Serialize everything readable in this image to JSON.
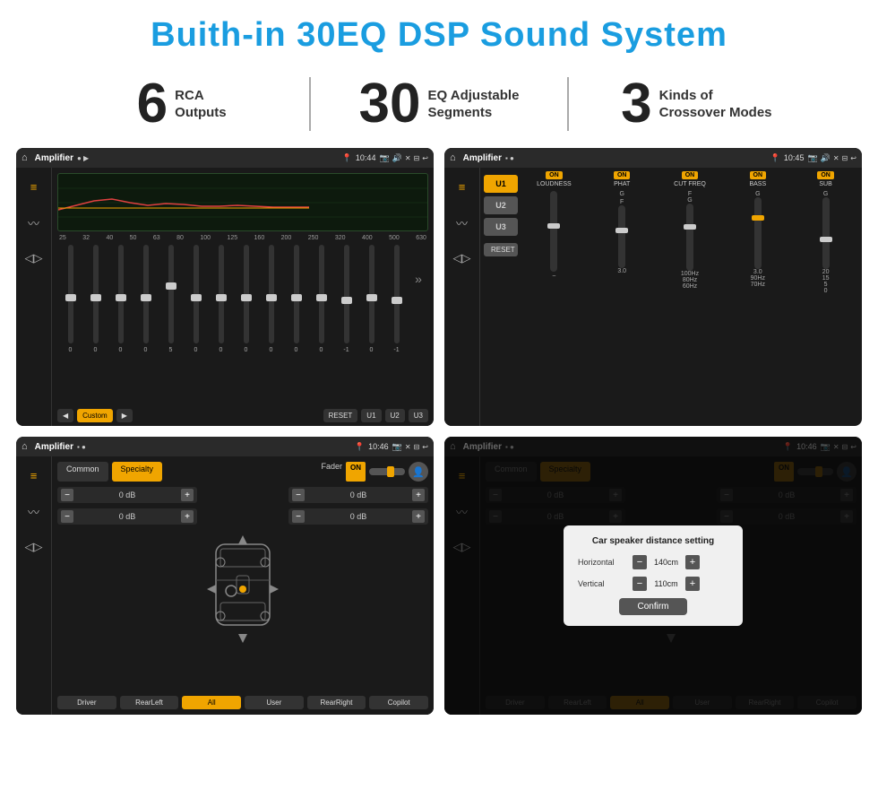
{
  "header": {
    "title": "Buith-in 30EQ DSP Sound System"
  },
  "stats": [
    {
      "number": "6",
      "text": "RCA\nOutputs"
    },
    {
      "number": "30",
      "text": "EQ Adjustable\nSegments"
    },
    {
      "number": "3",
      "text": "Kinds of\nCrossover Modes"
    }
  ],
  "screens": [
    {
      "id": "screen-1",
      "statusBar": {
        "appName": "Amplifier",
        "time": "10:44"
      },
      "type": "eq"
    },
    {
      "id": "screen-2",
      "statusBar": {
        "appName": "Amplifier",
        "time": "10:45"
      },
      "type": "crossover"
    },
    {
      "id": "screen-3",
      "statusBar": {
        "appName": "Amplifier",
        "time": "10:46"
      },
      "type": "fader"
    },
    {
      "id": "screen-4",
      "statusBar": {
        "appName": "Amplifier",
        "time": "10:46"
      },
      "type": "fader-dialog"
    }
  ],
  "eq": {
    "freqLabels": [
      "25",
      "32",
      "40",
      "50",
      "63",
      "80",
      "100",
      "125",
      "160",
      "200",
      "250",
      "320",
      "400",
      "500",
      "630"
    ],
    "sliderValues": [
      "0",
      "0",
      "0",
      "0",
      "5",
      "0",
      "0",
      "0",
      "0",
      "0",
      "0",
      "0",
      "-1",
      "0",
      "-1"
    ],
    "buttons": [
      "◀",
      "Custom",
      "▶",
      "RESET",
      "U1",
      "U2",
      "U3"
    ]
  },
  "crossover": {
    "uButtons": [
      "U1",
      "U2",
      "U3"
    ],
    "channels": [
      {
        "name": "LOUDNESS",
        "on": true
      },
      {
        "name": "PHAT",
        "on": true
      },
      {
        "name": "CUT FREQ",
        "on": true
      },
      {
        "name": "BASS",
        "on": true
      },
      {
        "name": "SUB",
        "on": true
      }
    ],
    "resetLabel": "RESET"
  },
  "fader": {
    "tabs": [
      "Common",
      "Specialty"
    ],
    "activeTab": "Specialty",
    "faderLabel": "Fader",
    "onLabel": "ON",
    "dbValues": [
      "0 dB",
      "0 dB",
      "0 dB",
      "0 dB"
    ],
    "footerButtons": [
      "Driver",
      "RearLeft",
      "All",
      "User",
      "RearRight",
      "Copilot"
    ]
  },
  "dialog": {
    "title": "Car speaker distance setting",
    "horizontalLabel": "Horizontal",
    "horizontalValue": "140cm",
    "verticalLabel": "Vertical",
    "verticalValue": "110cm",
    "confirmLabel": "Confirm"
  }
}
